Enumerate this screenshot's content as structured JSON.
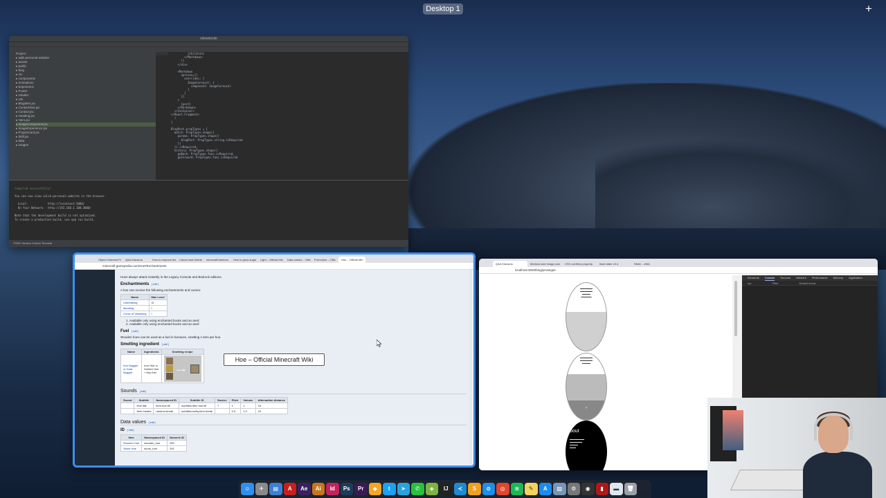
{
  "desktop": {
    "label": "Desktop 1",
    "add_symbol": "+"
  },
  "ide": {
    "title": "sitewebsite",
    "project_header": "Project",
    "tree": [
      "salik-personal-website",
      "assets",
      "public",
      "blog",
      "src",
      "components",
      "Animations",
      "Experience",
      "Footer",
      "Header",
      "UIs",
      "BlogItem.jsx",
      "ContentText.jsx",
      "Contact.jsx",
      "Heading.jsx",
      "Hero.jsx",
      "ImageComponent.jsx",
      "ImageExperience.jsx",
      "ProjectCard.jsx",
      "Skill.jsx",
      "data",
      "images"
    ],
    "code_lines": [
      "          {children}",
      "        </Markdown>",
      "      )}",
      "    </div>",
      "",
      "    <Markdown",
      "      options={{",
      "        overrides: {",
      "          ImageCarousel: {",
      "            component: ImageCarousel",
      "          }",
      "        }",
      "      }}",
      "    >",
      "      {post}",
      "    </Markdown>",
      "  </Container>",
      "</React.Fragment>",
      "  )",
      "}",
      "",
      "BlogPost.propTypes = {",
      "  match: PropTypes.shape({",
      "    params: PropTypes.shape({",
      "      blogPost: PropTypes.string.isRequired",
      "    })",
      "  }).isRequired,",
      "  history: PropTypes.shape({",
      "    goBack: PropTypes.func.isRequired,",
      "    goForward: PropTypes.func.isRequired"
    ],
    "terminal_tab": "Terminal",
    "terminal_lines": [
      {
        "text": "Compiled successfully!",
        "kind": "ok"
      },
      {
        "text": "",
        "kind": ""
      },
      {
        "text": "You can now view salik-personal-website in the browser.",
        "kind": ""
      },
      {
        "text": "",
        "kind": ""
      },
      {
        "text": "  Local:            http://localhost:3000/",
        "kind": ""
      },
      {
        "text": "  On Your Network:  http://192.168.1.100:3000/",
        "kind": ""
      },
      {
        "text": "",
        "kind": ""
      },
      {
        "text": "Note that the development build is not optimized.",
        "kind": ""
      },
      {
        "text": "To create a production build, use npm run build.",
        "kind": ""
      }
    ],
    "status": "TODO   Version Control   Terminal"
  },
  "wiki": {
    "tabs": [
      "Object Oriented Pr",
      "Q&A Klavaros",
      "How to improve the",
      "Cancel and Delete",
      "minecraft:bamboo",
      "How to grow sugar",
      "Light – Official Min",
      "Data values – Offic",
      "Promotion – Offic",
      "Hoe – Official Min"
    ],
    "url": "minecraft.gamepedia.com/Hoe#Enchantments",
    "intro": "Hoes always attack instantly in the Legacy Console and Bedrock editions.",
    "enchantments_heading": "Enchantments",
    "edit_label": "[ edit ]",
    "enchant_intro": "A hoe can receive the following enchantments and curses:",
    "enchant_cols": [
      "Name",
      "Max Level"
    ],
    "enchant_rows": [
      [
        "Unbreaking",
        "III"
      ],
      [
        "Mending",
        "I"
      ],
      [
        "Curse of Vanishing",
        "I"
      ]
    ],
    "enchant_notes": [
      "1. Available only using enchanted books and an anvil",
      "2. Available only using enchanted books and an anvil"
    ],
    "fuel_heading": "Fuel",
    "fuel_text": "Wooden hoes can be used as a fuel in furnaces, smelting 1 item per hoe.",
    "smelting_heading": "Smelting ingredient",
    "smelt_cols": [
      "Name",
      "Ingredients",
      "Smelting recipe"
    ],
    "smelt_name": "Iron Nugget or Gold Nugget",
    "smelt_ingredients": "Iron Hoe or Golden Hoe + Any fuel",
    "sounds_heading": "Sounds",
    "sound_cols": [
      "Sound",
      "Subtitle",
      "Namespaced ID",
      "Subtitle ID",
      "Source",
      "Pitch",
      "Volume",
      "Attenuation distance"
    ],
    "sound_rows": [
      [
        "",
        "Hoe tills",
        "item.hoe.till",
        "subtitles.item.hoe.till",
        "?",
        "1",
        "1",
        "16"
      ],
      [
        "",
        "Item breaks",
        "random.break",
        "subtitles.entity.item.break",
        "",
        "0.9",
        "1.0",
        "16"
      ]
    ],
    "data_values_heading": "Data values",
    "id_heading": "ID",
    "id_cols": [
      "Item",
      "Namespaced ID",
      "Numeric ID"
    ],
    "id_rows": [
      [
        "Wooden Hoe",
        "wooden_hoe",
        "290"
      ],
      [
        "Stone Hoe",
        "stone_hoe",
        "291"
      ]
    ]
  },
  "tooltip": {
    "text": "Hoe – Official Minecraft Wiki"
  },
  "dev": {
    "tabs": [
      "Q&A Klavaros",
      "Medium-size image.com",
      "CSS overflow property",
      "flush latter v3.4",
      "Slider - UMA"
    ],
    "url": "localhost:3000/blog/prototype",
    "devtools_tabs": [
      "Elements",
      "Console",
      "Sources",
      "Network",
      "Performance",
      "Memory",
      "Application"
    ],
    "devtools_filter": [
      "top",
      "Filter",
      "Default levels"
    ],
    "oval3_heading": "bout"
  },
  "dock": {
    "icons": [
      {
        "name": "finder-icon",
        "glyph": "☺",
        "color": "#2f8ff0"
      },
      {
        "name": "launchpad-icon",
        "glyph": "✈",
        "color": "#8a8a8a"
      },
      {
        "name": "files-icon",
        "glyph": "▤",
        "color": "#3f7fd0"
      },
      {
        "name": "acrobat-icon",
        "glyph": "A",
        "color": "#c8201e"
      },
      {
        "name": "after-effects-icon",
        "glyph": "Ae",
        "color": "#3a2060"
      },
      {
        "name": "illustrator-icon",
        "glyph": "Ai",
        "color": "#c7771a"
      },
      {
        "name": "indesign-icon",
        "glyph": "Id",
        "color": "#c2235f"
      },
      {
        "name": "photoshop-icon",
        "glyph": "Ps",
        "color": "#1d3b5c"
      },
      {
        "name": "premiere-icon",
        "glyph": "Pr",
        "color": "#3a1a55"
      },
      {
        "name": "sketch-icon",
        "glyph": "◆",
        "color": "#f5a623"
      },
      {
        "name": "twitter-icon",
        "glyph": "t",
        "color": "#1da1f2"
      },
      {
        "name": "telegram-icon",
        "glyph": "➤",
        "color": "#2aa3dc"
      },
      {
        "name": "whatsapp-icon",
        "glyph": "✆",
        "color": "#27c23e"
      },
      {
        "name": "android-icon",
        "glyph": "◈",
        "color": "#7cb342"
      },
      {
        "name": "ide-icon",
        "glyph": "IJ",
        "color": "#222"
      },
      {
        "name": "vscode-icon",
        "glyph": "≺",
        "color": "#1f8ad2"
      },
      {
        "name": "sublime-icon",
        "glyph": "S",
        "color": "#f0a020"
      },
      {
        "name": "safari-icon",
        "glyph": "⊘",
        "color": "#1c8fe6"
      },
      {
        "name": "chrome-icon",
        "glyph": "◎",
        "color": "#e0452e"
      },
      {
        "name": "spotify-icon",
        "glyph": "≋",
        "color": "#1db954"
      },
      {
        "name": "notes-icon",
        "glyph": "✎",
        "color": "#f4d35e"
      },
      {
        "name": "app-store-icon",
        "glyph": "A",
        "color": "#1a8bf0"
      },
      {
        "name": "preview-icon",
        "glyph": "▨",
        "color": "#7796b6"
      },
      {
        "name": "system-prefs-icon",
        "glyph": "⚙",
        "color": "#777"
      },
      {
        "name": "camera-icon",
        "glyph": "◉",
        "color": "#333"
      },
      {
        "name": "pdf-icon",
        "glyph": "▮",
        "color": "#b01818"
      },
      {
        "name": "folder-icon",
        "glyph": "▬",
        "color": "#dfe6ee"
      },
      {
        "name": "trash-icon",
        "glyph": "🗑",
        "color": "#9aa0a8"
      }
    ]
  },
  "colors": {
    "accent": "#3d8ef0",
    "link": "#0645ad"
  }
}
